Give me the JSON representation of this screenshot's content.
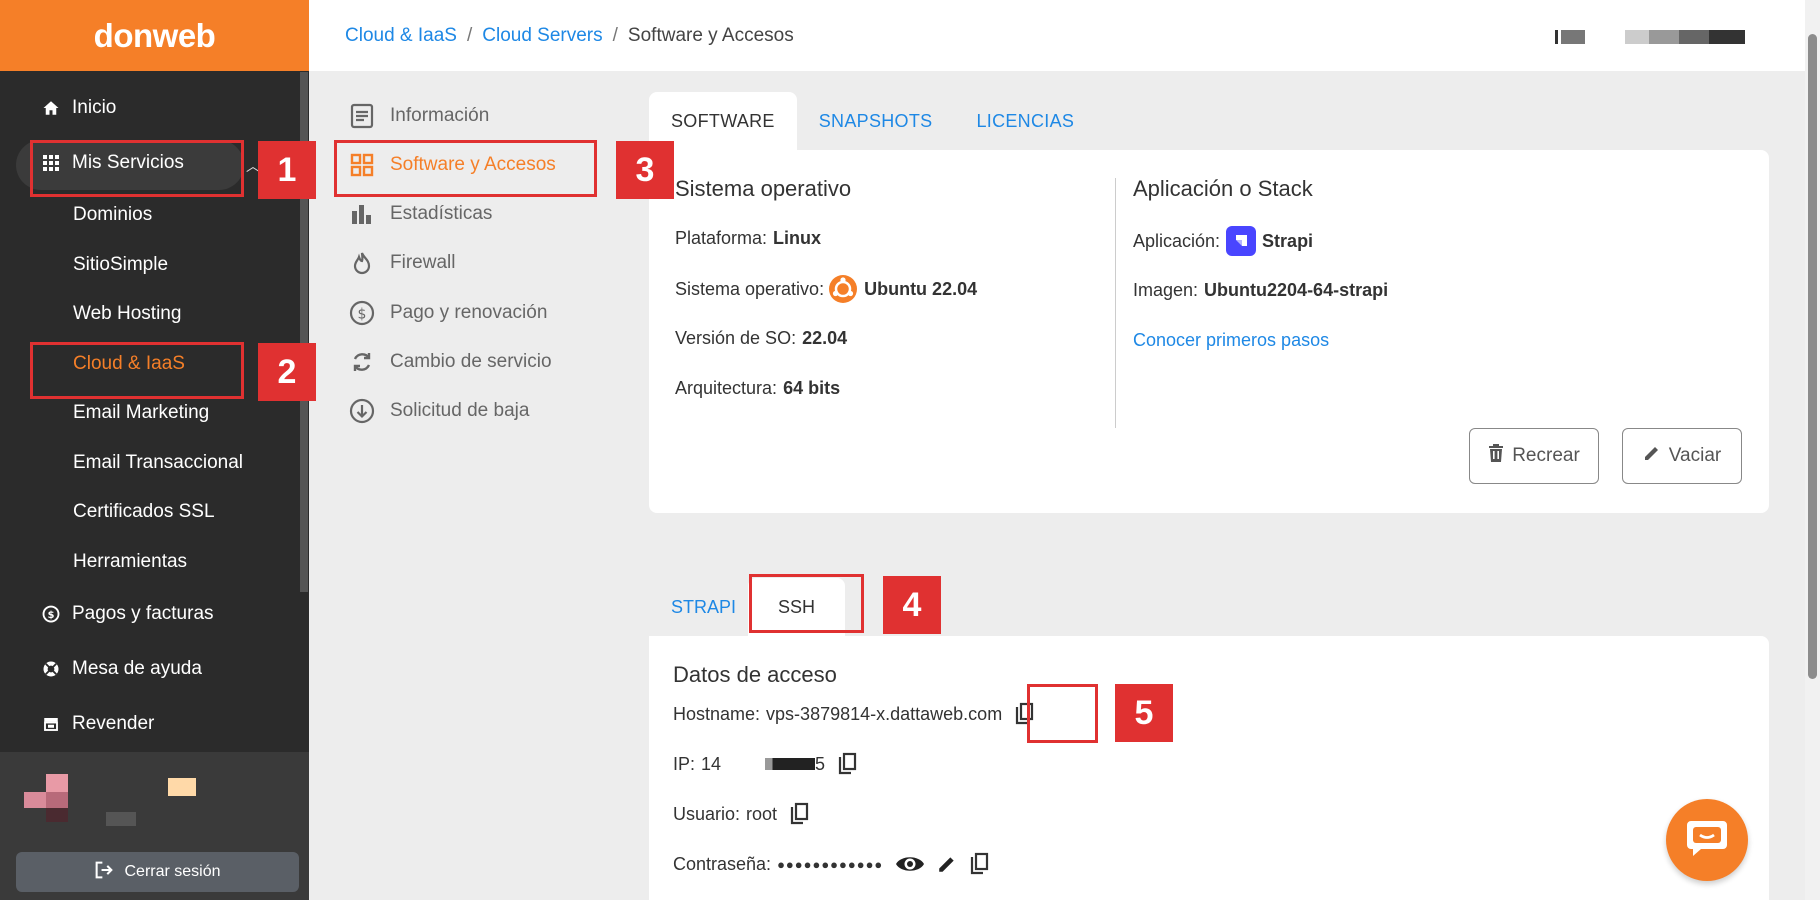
{
  "brand": {
    "logo_text": "donweb",
    "accent": "#f57f28"
  },
  "sidebar": {
    "items": [
      {
        "label": "Inicio",
        "icon": "home-icon"
      },
      {
        "label": "Mis Servicios",
        "icon": "grid-icon"
      },
      {
        "label": "Pagos y facturas",
        "icon": "dollar-circle-icon"
      },
      {
        "label": "Mesa de ayuda",
        "icon": "lifebuoy-icon"
      },
      {
        "label": "Revender",
        "icon": "store-icon"
      }
    ],
    "sub_items": [
      "Dominios",
      "SitioSimple",
      "Web Hosting",
      "Cloud & IaaS",
      "Email Marketing",
      "Email Transaccional",
      "Certificados SSL",
      "Herramientas"
    ],
    "active_sub": "Cloud & IaaS",
    "logout_label": "Cerrar sesión"
  },
  "breadcrumb": {
    "items": [
      "Cloud & IaaS",
      "Cloud Servers",
      "Software y Accesos"
    ],
    "separator": "/"
  },
  "submenu": {
    "items": [
      {
        "label": "Información",
        "icon": "document-icon"
      },
      {
        "label": "Software y Accesos",
        "icon": "apps-grid-icon"
      },
      {
        "label": "Estadísticas",
        "icon": "bar-chart-icon"
      },
      {
        "label": "Firewall",
        "icon": "flame-icon"
      },
      {
        "label": "Pago y renovación",
        "icon": "dollar-circle-icon"
      },
      {
        "label": "Cambio de servicio",
        "icon": "refresh-icon"
      },
      {
        "label": "Solicitud de baja",
        "icon": "arrow-down-circle-icon"
      }
    ],
    "active": "Software y Accesos"
  },
  "top_tabs": [
    "SOFTWARE",
    "SNAPSHOTS",
    "LICENCIAS"
  ],
  "software": {
    "os_title": "Sistema operativo",
    "platform_label": "Plataforma:",
    "platform_value": "Linux",
    "os_label": "Sistema operativo:",
    "os_value": "Ubuntu 22.04",
    "version_label": "Versión de SO:",
    "version_value": "22.04",
    "arch_label": "Arquitectura:",
    "arch_value": "64 bits",
    "app_title": "Aplicación o Stack",
    "app_label": "Aplicación:",
    "app_value": "Strapi",
    "image_label": "Imagen:",
    "image_value": "Ubuntu2204-64-strapi",
    "first_steps_link": "Conocer primeros pasos",
    "recreate_label": "Recrear",
    "empty_label": "Vaciar"
  },
  "access_tabs": [
    "STRAPI",
    "SSH"
  ],
  "access": {
    "title": "Datos de acceso",
    "hostname_label": "Hostname:",
    "hostname_value": "vps-3879814-x.dattaweb.com",
    "ip_label": "IP:",
    "ip_prefix": "14",
    "ip_suffix": "5",
    "user_label": "Usuario:",
    "user_value": "root",
    "password_label": "Contraseña:",
    "password_value": "●●●●●●●●●●●●"
  },
  "annotations": [
    "1",
    "2",
    "3",
    "4",
    "5"
  ],
  "colors": {
    "annotation_red": "#e03131",
    "link_blue": "#1e88e5",
    "sidebar_bg": "#2b2b2b"
  }
}
